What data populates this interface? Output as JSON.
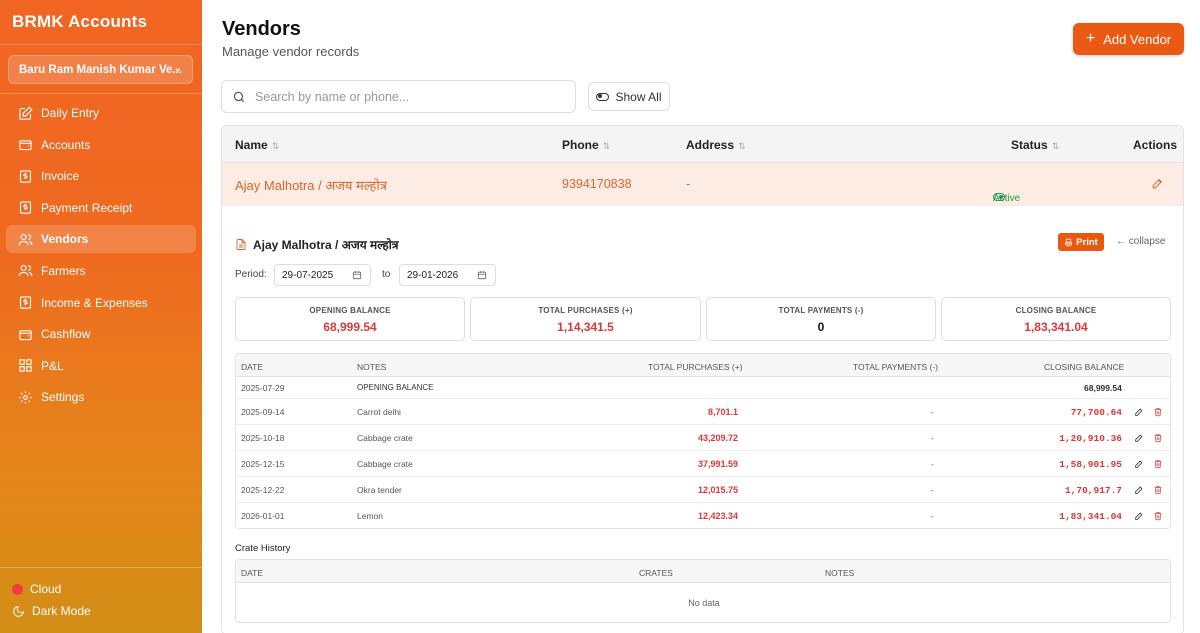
{
  "app": {
    "brand": "BRMK Accounts",
    "business": "Baru Ram Manish Kumar Ve..."
  },
  "nav": [
    {
      "label": "Daily Entry",
      "icon": "edit-square-icon"
    },
    {
      "label": "Accounts",
      "icon": "wallet-icon"
    },
    {
      "label": "Invoice",
      "icon": "dollar-doc-icon"
    },
    {
      "label": "Payment Receipt",
      "icon": "dollar-doc-icon"
    },
    {
      "label": "Vendors",
      "icon": "users-icon",
      "active": true
    },
    {
      "label": "Farmers",
      "icon": "users-icon"
    },
    {
      "label": "Income & Expenses",
      "icon": "dollar-doc-icon"
    },
    {
      "label": "Cashflow",
      "icon": "wallet-icon"
    },
    {
      "label": "P&L",
      "icon": "grid-icon"
    },
    {
      "label": "Settings",
      "icon": "gear-icon"
    }
  ],
  "footer": {
    "cloud": "Cloud",
    "dark_mode": "Dark Mode",
    "cloud_color": "#f03c3c"
  },
  "page": {
    "title": "Vendors",
    "subtitle": "Manage vendor records",
    "add_button": "Add Vendor"
  },
  "search": {
    "placeholder": "Search by name or phone...",
    "show_all": "Show All"
  },
  "vendor_table": {
    "headers": {
      "name": "Name",
      "phone": "Phone",
      "address": "Address",
      "status": "Status",
      "actions": "Actions"
    },
    "rows": [
      {
        "name": "Ajay Malhotra / अजय मल्होत्र",
        "phone": "9394170838",
        "address": "-",
        "status": "Active"
      }
    ]
  },
  "detail": {
    "title": "Ajay Malhotra / अजय मल्होत्र",
    "print": "Print",
    "collapse": "collapse",
    "period_label": "Period:",
    "from": "29-07-2025",
    "to_label": "to",
    "to": "29-01-2026",
    "summary": [
      {
        "label": "OPENING BALANCE",
        "value": "68,999.54"
      },
      {
        "label": "TOTAL PURCHASES (+)",
        "value": "1,14,341.5"
      },
      {
        "label": "TOTAL PAYMENTS (-)",
        "value": "0"
      },
      {
        "label": "CLOSING BALANCE",
        "value": "1,83,341.04"
      }
    ],
    "ledger_headers": {
      "date": "DATE",
      "notes": "NOTES",
      "purchases": "TOTAL PURCHASES (+)",
      "payments": "TOTAL PAYMENTS (-)",
      "closing": "CLOSING BALANCE"
    },
    "opening_row": {
      "date": "2025-07-29",
      "notes": "OPENING BALANCE",
      "closing": "68,999.54"
    },
    "ledger_rows": [
      {
        "date": "2025-09-14",
        "notes": "Carrot delhi",
        "purchases": "8,701.1",
        "payments": "-",
        "closing": "77,700.64"
      },
      {
        "date": "2025-10-18",
        "notes": "Cabbage crate",
        "purchases": "43,209.72",
        "payments": "-",
        "closing": "1,20,910.36"
      },
      {
        "date": "2025-12-15",
        "notes": "Cabbage crate",
        "purchases": "37,991.59",
        "payments": "-",
        "closing": "1,58,901.95"
      },
      {
        "date": "2025-12-22",
        "notes": "Okra tender",
        "purchases": "12,015.75",
        "payments": "-",
        "closing": "1,70,917.7"
      },
      {
        "date": "2026-01-01",
        "notes": "Lemon",
        "purchases": "12,423.34",
        "payments": "-",
        "closing": "1,83,341.04"
      }
    ],
    "crate_title": "Crate History",
    "crate_headers": {
      "date": "DATE",
      "crates": "CRATES",
      "notes": "NOTES"
    },
    "crate_empty": "No data"
  },
  "colors": {
    "accent": "#ea5a12",
    "negative": "#d63a3a",
    "active_status": "#1e9e4a"
  }
}
